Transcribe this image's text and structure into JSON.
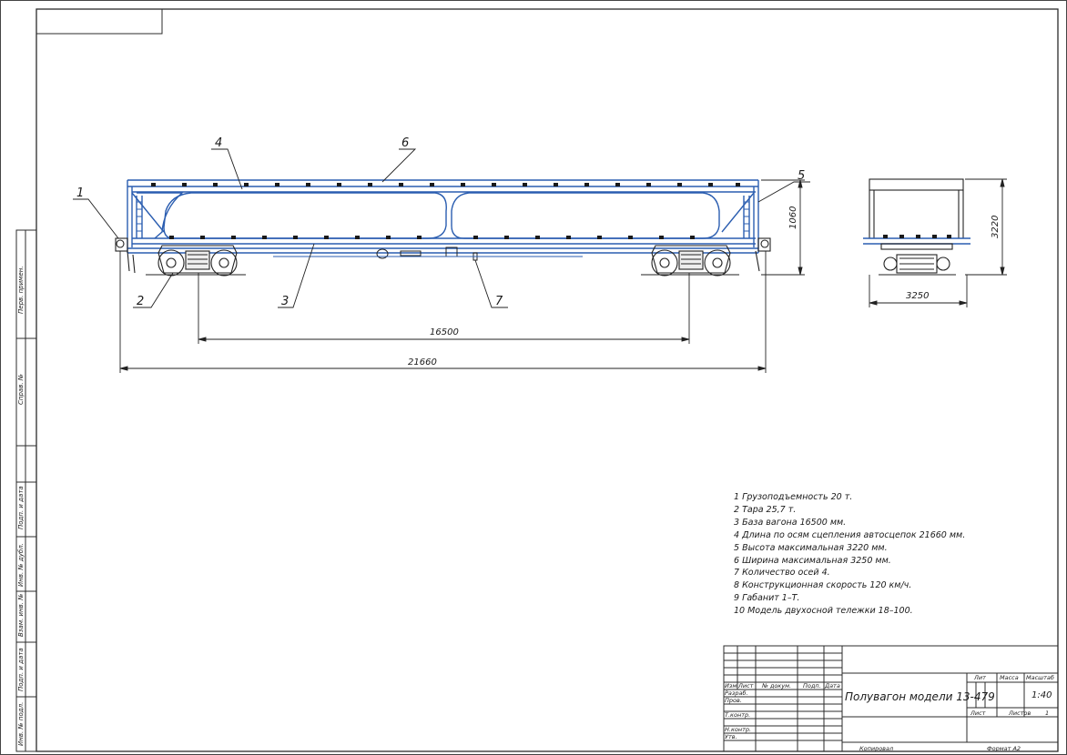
{
  "callouts": [
    "1",
    "2",
    "3",
    "4",
    "5",
    "6",
    "7"
  ],
  "dimensions": {
    "base": "16500",
    "length": "21660",
    "height_side": "1060",
    "height_max": "3220",
    "width": "3250"
  },
  "notes": [
    "1  Грузоподъемность 20 т.",
    "2  Тара 25,7 т.",
    "3  База вагона 16500 мм.",
    "4  Длина по осям сцепления автосцепок 21660 мм.",
    "5  Высота максимальная 3220 мм.",
    "6  Ширина максимальная 3250 мм.",
    "7  Количество осей 4.",
    "8  Конструкционная скорость 120 км/ч.",
    "9  Габанит 1–Т.",
    "10  Модель двухосной тележки 18–100."
  ],
  "margin_labels": [
    "Перв. примен.",
    "Справ. №",
    "Подп. и дата",
    "Инв. № дубл.",
    "Взам. инв. №",
    "Подп. и дата",
    "Инв. № подл."
  ],
  "title_block": {
    "title": "Полувагон модели 13-479",
    "row_labels": [
      "Изм",
      "Лист",
      "№ докум.",
      "Подп.",
      "Дата"
    ],
    "roles": [
      "Разраб.",
      "Пров.",
      "Т.контр.",
      "",
      "Н.контр.",
      "Утв."
    ],
    "lit_label": "Лит",
    "mass_label": "Масса",
    "scale_label": "Масштаб",
    "scale_value": "1:40",
    "sheet_label": "Лист",
    "sheets_label": "Листов",
    "sheets_value": "1",
    "copied": "Копировал",
    "format": "Формат   А2"
  },
  "colors": {
    "line": "#222222",
    "blue": "#2a5db0",
    "frame": "#2b2b2b"
  }
}
